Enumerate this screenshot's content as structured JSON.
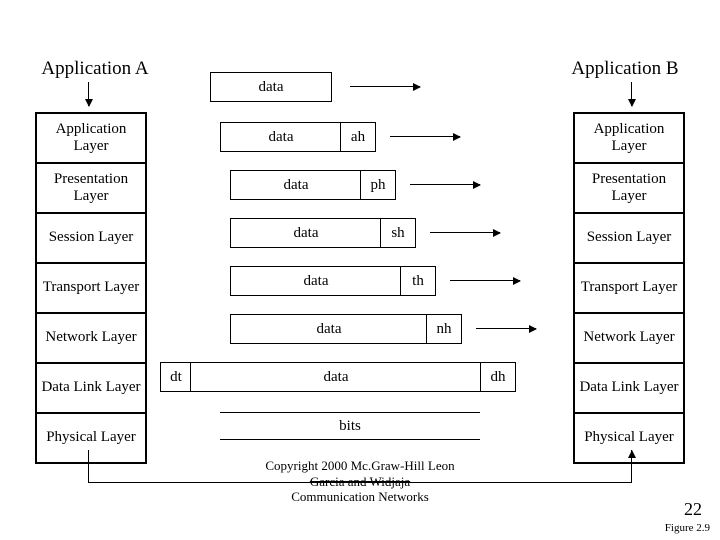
{
  "titles": {
    "left": "Application A",
    "right": "Application B"
  },
  "layers": [
    "Application Layer",
    "Presentation Layer",
    "Session Layer",
    "Transport Layer",
    "Network Layer",
    "Data Link Layer",
    "Physical Layer"
  ],
  "pdu": {
    "top_data": "data",
    "rows": [
      {
        "data": "data",
        "header": "ah"
      },
      {
        "data": "data",
        "header": "ph"
      },
      {
        "data": "data",
        "header": "sh"
      },
      {
        "data": "data",
        "header": "th"
      },
      {
        "data": "data",
        "header": "nh"
      },
      {
        "trailer": "dt",
        "data": "data",
        "header": "dh"
      }
    ],
    "bits": "bits"
  },
  "copyright": {
    "line1": "Copyright 2000 Mc.Graw-Hill Leon",
    "line2": "Garcia and Widjaja",
    "line3": "Communication Networks"
  },
  "page_number": "22",
  "figure_label": "Figure 2.9"
}
